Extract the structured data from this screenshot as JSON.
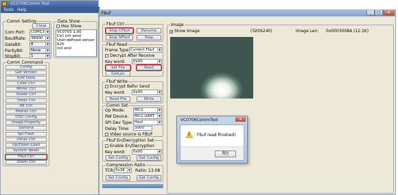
{
  "main_window": {
    "title": "VC0706Comm Tool",
    "menu": [
      "Tools",
      "Help"
    ],
    "comm_setting": {
      "title": "Comm Setting",
      "close_label": "Close",
      "fields": [
        {
          "label": "Com Port:",
          "value": "COM13"
        },
        {
          "label": "BaudRate:",
          "value": "38400"
        },
        {
          "label": "DataBit:",
          "value": "8"
        },
        {
          "label": "ParityBit:",
          "value": "None"
        },
        {
          "label": "StopBit:",
          "value": "1"
        }
      ]
    },
    "data_show": {
      "title": "Data Show",
      "hex_show_label": "Hex Show",
      "lines": [
        "VC0703 1.00",
        "Ctrl infr exist",
        "User-defined sensor",
        "625",
        "Init end"
      ]
    },
    "comm_command": {
      "title": "Comm Command",
      "buttons": [
        "Config",
        "Get Version",
        "R/W Data",
        "Color Ctrl",
        "Mirror Ctrl",
        "Power Ctrl",
        "Timer Ctrl",
        "AE Ctrl",
        "Motion Ctrl",
        "OSD Config",
        "Image Property",
        "Gamma",
        "Spi Flash",
        "Other Ctrl",
        "Up/Down Load",
        "System Reset",
        "Fbuf Ctrl",
        "Zoom Ctrl"
      ],
      "highlighted": "Fbuf Ctrl"
    }
  },
  "fbuf_window": {
    "title": "Fbuf",
    "fbuf_ctrl": {
      "title": "Fbuf Ctrl",
      "stop_cfbuf": "Stop CFbuf",
      "resume": "Resume",
      "stop_nfbuf": "Stop NFbuf",
      "step": "Step"
    },
    "fbuf_read": {
      "title": "Fbuf Read",
      "frame_type_label": "Frame Type:",
      "frame_type_value": "Current Fbuf",
      "decrypt_label": "Decrypt After Receive",
      "key_word_label": "Key word:",
      "key_word_value": "0x00",
      "set_file": "Set File",
      "read": "Read",
      "getlen": "GetLen"
    },
    "fbuf_write": {
      "title": "Fbuf Write",
      "encrypt_label": "Encrypt Befor Send",
      "key_word_label": "Key word:",
      "key_word_value": "0x00",
      "read_file": "Read File",
      "write": "Write"
    },
    "comm_set": {
      "title": "Comm Set",
      "rows": [
        {
          "label": "Op Mode:",
          "value": "MCU"
        },
        {
          "label": "RW Device:",
          "value": "MCU UART"
        },
        {
          "label": "SPI Dev Type:",
          "value": "Host"
        },
        {
          "label": "Delay Time:",
          "value": "3000"
        }
      ],
      "video_source_label": "Video source is FBUF"
    },
    "enc_set": {
      "title": "Fbuf En/Decryption Set",
      "enable_label": "Enable En/Decryption",
      "key_word_label": "Key word:",
      "key_word_value": "0x00",
      "set_config": "Set Config",
      "get_config": "Get Config"
    },
    "compression": {
      "title": "Compression Ratio",
      "tcr_label": "TCR:",
      "tcr_value": "0x36",
      "ratio_label": "Ratio:",
      "ratio_value": "13.08",
      "set_config": "Set Config",
      "get_config": "Get Config"
    },
    "progress_fraction": 1.0,
    "image": {
      "title": "Image",
      "show_image_label": "Show Image",
      "resolution": "(320X240)",
      "image_len_label": "Image Len:",
      "image_len_value": "0x0003008A (12.1K)"
    }
  },
  "dialog": {
    "title": "VC0706CommTool",
    "message": "Fbuf read finished!",
    "ok_label": "확인"
  },
  "colors": {
    "highlight_red": "#e01020",
    "titlebar_blue": "#7ea2cf",
    "progress_blue": "#3d7fdc"
  }
}
